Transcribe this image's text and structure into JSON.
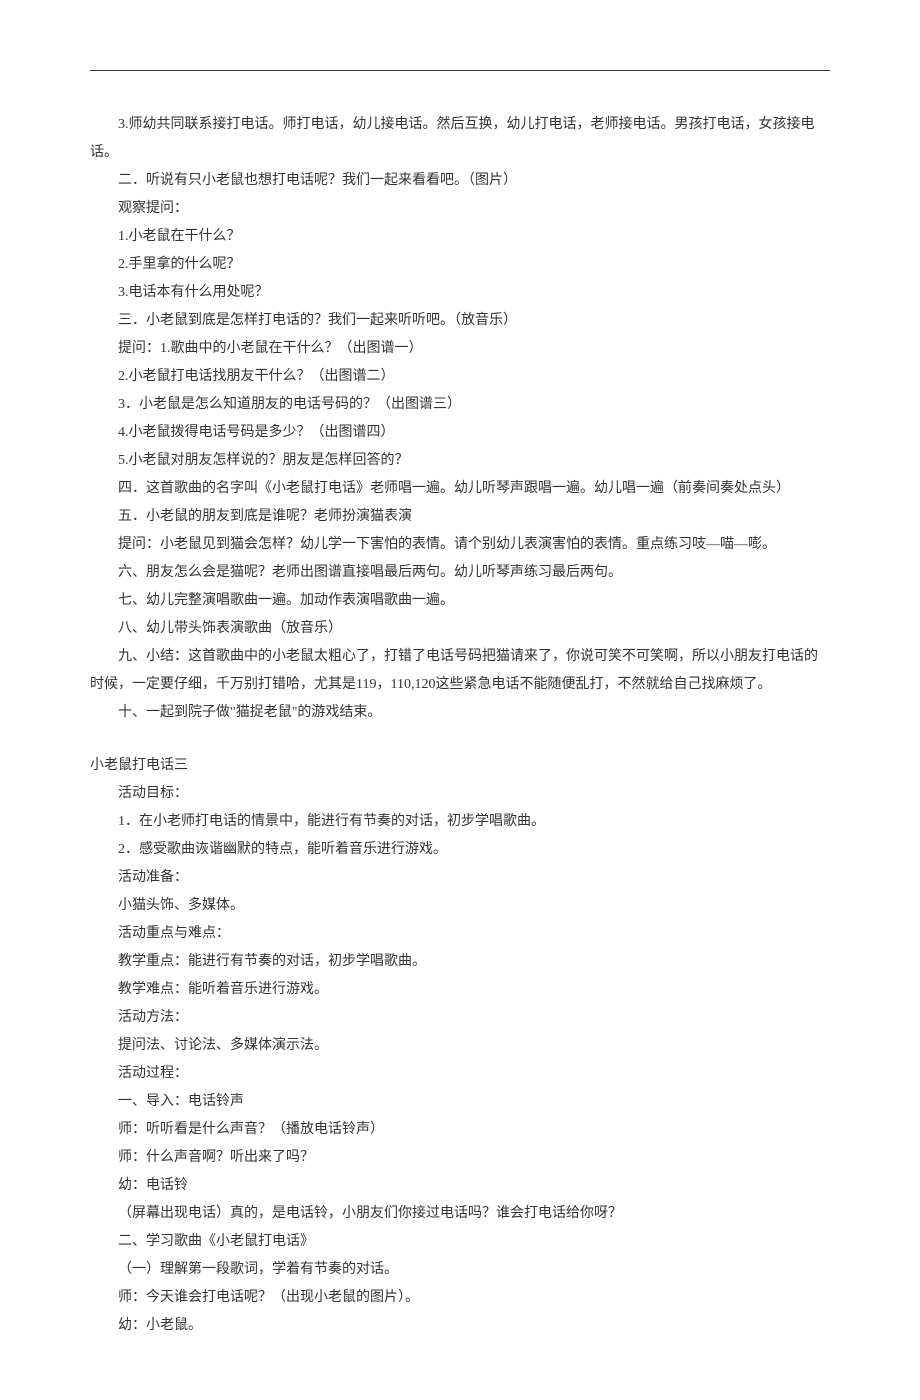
{
  "lines": [
    {
      "cls": "para",
      "text": "3.师幼共同联系接打电话。师打电话，幼儿接电话。然后互换，幼儿打电话，老师接电话。男孩打电话，女孩接电"
    },
    {
      "cls": "no-indent",
      "text": "话。"
    },
    {
      "cls": "para",
      "text": "二．听说有只小老鼠也想打电话呢？我们一起来看看吧。（图片）"
    },
    {
      "cls": "para",
      "text": "观察提问："
    },
    {
      "cls": "para",
      "text": "1.小老鼠在干什么？"
    },
    {
      "cls": "para",
      "text": "2.手里拿的什么呢？"
    },
    {
      "cls": "para",
      "text": "3.电话本有什么用处呢？"
    },
    {
      "cls": "para",
      "text": "三．小老鼠到底是怎样打电话的？我们一起来听听吧。（放音乐）"
    },
    {
      "cls": "para",
      "text": "提问：1.歌曲中的小老鼠在干什么？（出图谱一）"
    },
    {
      "cls": "para",
      "text": "2.小老鼠打电话找朋友干什么？（出图谱二）"
    },
    {
      "cls": "para",
      "text": "3．小老鼠是怎么知道朋友的电话号码的？（出图谱三）"
    },
    {
      "cls": "para",
      "text": "4.小老鼠拨得电话号码是多少？（出图谱四）"
    },
    {
      "cls": "para",
      "text": "5.小老鼠对朋友怎样说的？朋友是怎样回答的？"
    },
    {
      "cls": "para",
      "text": "四．这首歌曲的名字叫《小老鼠打电话》老师唱一遍。幼儿听琴声跟唱一遍。幼儿唱一遍（前奏间奏处点头）"
    },
    {
      "cls": "para",
      "text": "五．小老鼠的朋友到底是谁呢？老师扮演猫表演"
    },
    {
      "cls": "para",
      "text": "提问：小老鼠见到猫会怎样？幼儿学一下害怕的表情。请个别幼儿表演害怕的表情。重点练习吱—喵—嘭。"
    },
    {
      "cls": "para",
      "text": "六、朋友怎么会是猫呢？老师出图谱直接唱最后两句。幼儿听琴声练习最后两句。"
    },
    {
      "cls": "para",
      "text": "七、幼儿完整演唱歌曲一遍。加动作表演唱歌曲一遍。"
    },
    {
      "cls": "para",
      "text": "八、幼儿带头饰表演歌曲（放音乐）"
    },
    {
      "cls": "para",
      "text": "九、小结：这首歌曲中的小老鼠太粗心了，打错了电话号码把猫请来了，你说可笑不可笑啊，所以小朋友打电话的"
    },
    {
      "cls": "no-indent",
      "text": "时候，一定要仔细，千万别打错哈，尤其是119，110,120这些紧急电话不能随便乱打，不然就给自己找麻烦了。"
    },
    {
      "cls": "para",
      "text": "十、一起到院子做\"猫捉老鼠\"的游戏结束。"
    },
    {
      "cls": "blank",
      "text": ""
    },
    {
      "cls": "section-title",
      "text": "小老鼠打电话三"
    },
    {
      "cls": "para",
      "text": "活动目标："
    },
    {
      "cls": "para",
      "text": "1．在小老师打电话的情景中，能进行有节奏的对话，初步学唱歌曲。"
    },
    {
      "cls": "para",
      "text": "2．感受歌曲诙谐幽默的特点，能听着音乐进行游戏。"
    },
    {
      "cls": "para",
      "text": "活动准备："
    },
    {
      "cls": "para",
      "text": "小猫头饰、多媒体。"
    },
    {
      "cls": "para",
      "text": "活动重点与难点："
    },
    {
      "cls": "para",
      "text": "教学重点：能进行有节奏的对话，初步学唱歌曲。"
    },
    {
      "cls": "para",
      "text": "教学难点：能听着音乐进行游戏。"
    },
    {
      "cls": "para",
      "text": "活动方法："
    },
    {
      "cls": "para",
      "text": "提问法、讨论法、多媒体演示法。"
    },
    {
      "cls": "para",
      "text": "活动过程："
    },
    {
      "cls": "para",
      "text": "一、导入：电话铃声"
    },
    {
      "cls": "para",
      "text": "师：听听看是什么声音？（播放电话铃声）"
    },
    {
      "cls": "para",
      "text": "师：什么声音啊？听出来了吗？"
    },
    {
      "cls": "para",
      "text": "幼：电话铃"
    },
    {
      "cls": "para",
      "text": "（屏幕出现电话）真的，是电话铃，小朋友们你接过电话吗？谁会打电话给你呀？"
    },
    {
      "cls": "para",
      "text": "二、学习歌曲《小老鼠打电话》"
    },
    {
      "cls": "para",
      "text": "（一）理解第一段歌词，学着有节奏的对话。"
    },
    {
      "cls": "para",
      "text": "师：今天谁会打电话呢？（出现小老鼠的图片）。"
    },
    {
      "cls": "para",
      "text": "幼：小老鼠。"
    }
  ]
}
